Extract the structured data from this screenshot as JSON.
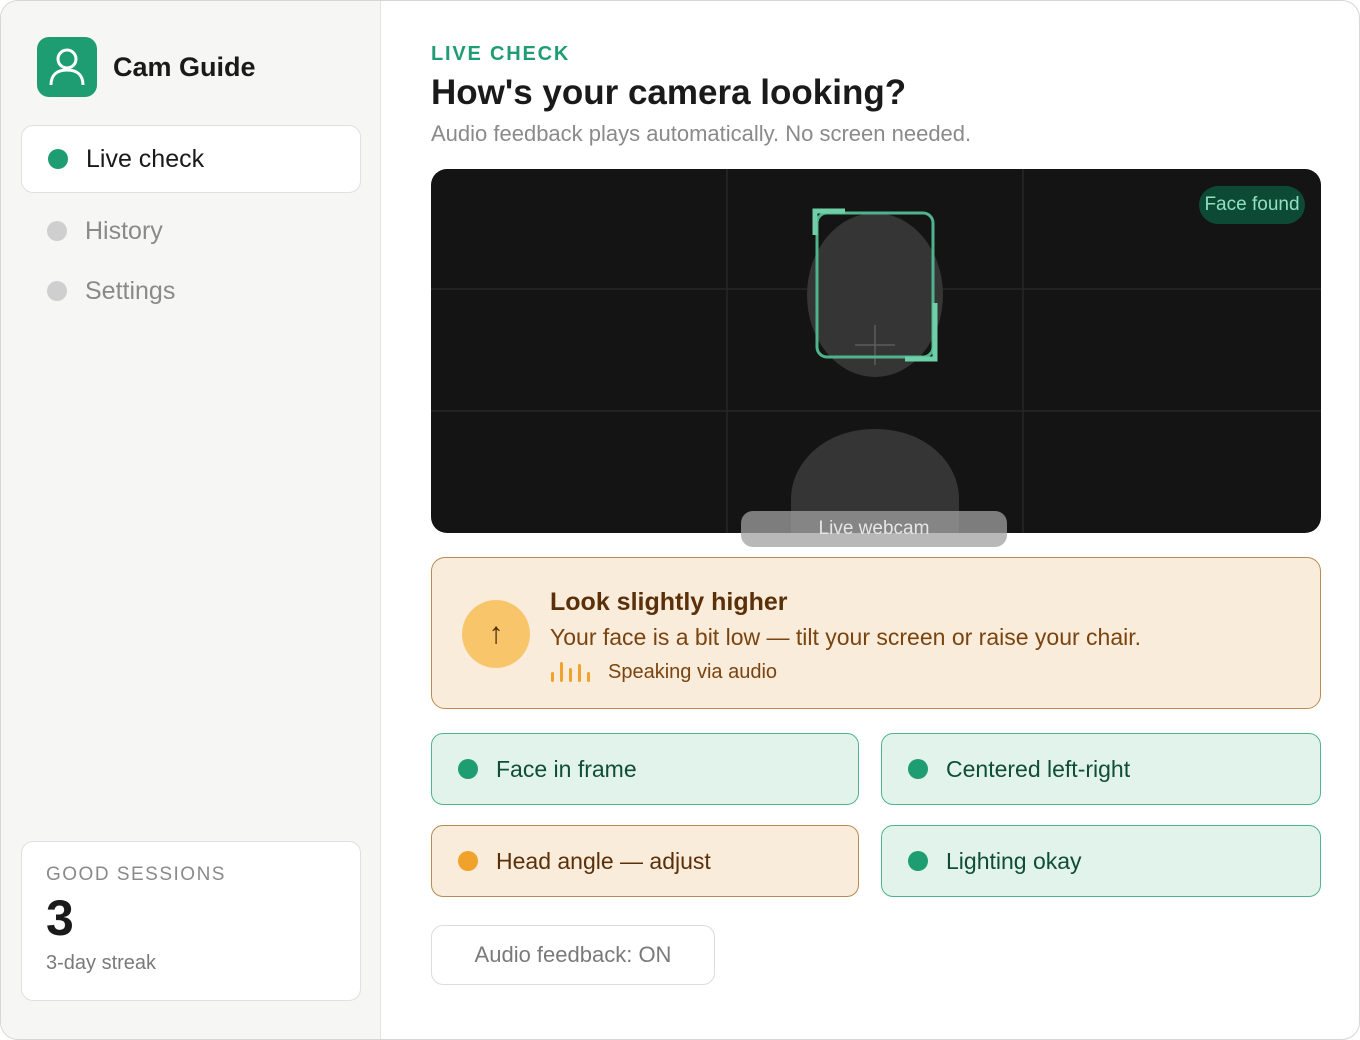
{
  "app": {
    "name": "Cam Guide",
    "logo_icon": "user-icon",
    "accent_color": "#1f9d72"
  },
  "sidebar": {
    "items": [
      {
        "label": "Live check",
        "active": true
      },
      {
        "label": "History",
        "active": false
      },
      {
        "label": "Settings",
        "active": false
      }
    ],
    "stats": {
      "label": "GOOD SESSIONS",
      "value": "3",
      "sub": "3-day streak"
    }
  },
  "main": {
    "eyebrow": "LIVE CHECK",
    "title": "How's your camera looking?",
    "subtitle": "Audio feedback plays automatically. No screen needed.",
    "camera": {
      "badge": "Face found",
      "caption": "Live webcam"
    },
    "alert": {
      "icon": "arrow-up-icon",
      "icon_glyph": "↑",
      "title": "Look slightly higher",
      "body": "Your face is a bit low — tilt your screen or raise your chair.",
      "audio_icon": "audio-waveform-icon",
      "audio_text": "Speaking via audio"
    },
    "checks": [
      {
        "label": "Face in frame",
        "status": "ok"
      },
      {
        "label": "Centered left-right",
        "status": "ok"
      },
      {
        "label": "Head angle — adjust",
        "status": "warn"
      },
      {
        "label": "Lighting okay",
        "status": "ok"
      }
    ],
    "audio_toggle": "Audio feedback: ON"
  }
}
